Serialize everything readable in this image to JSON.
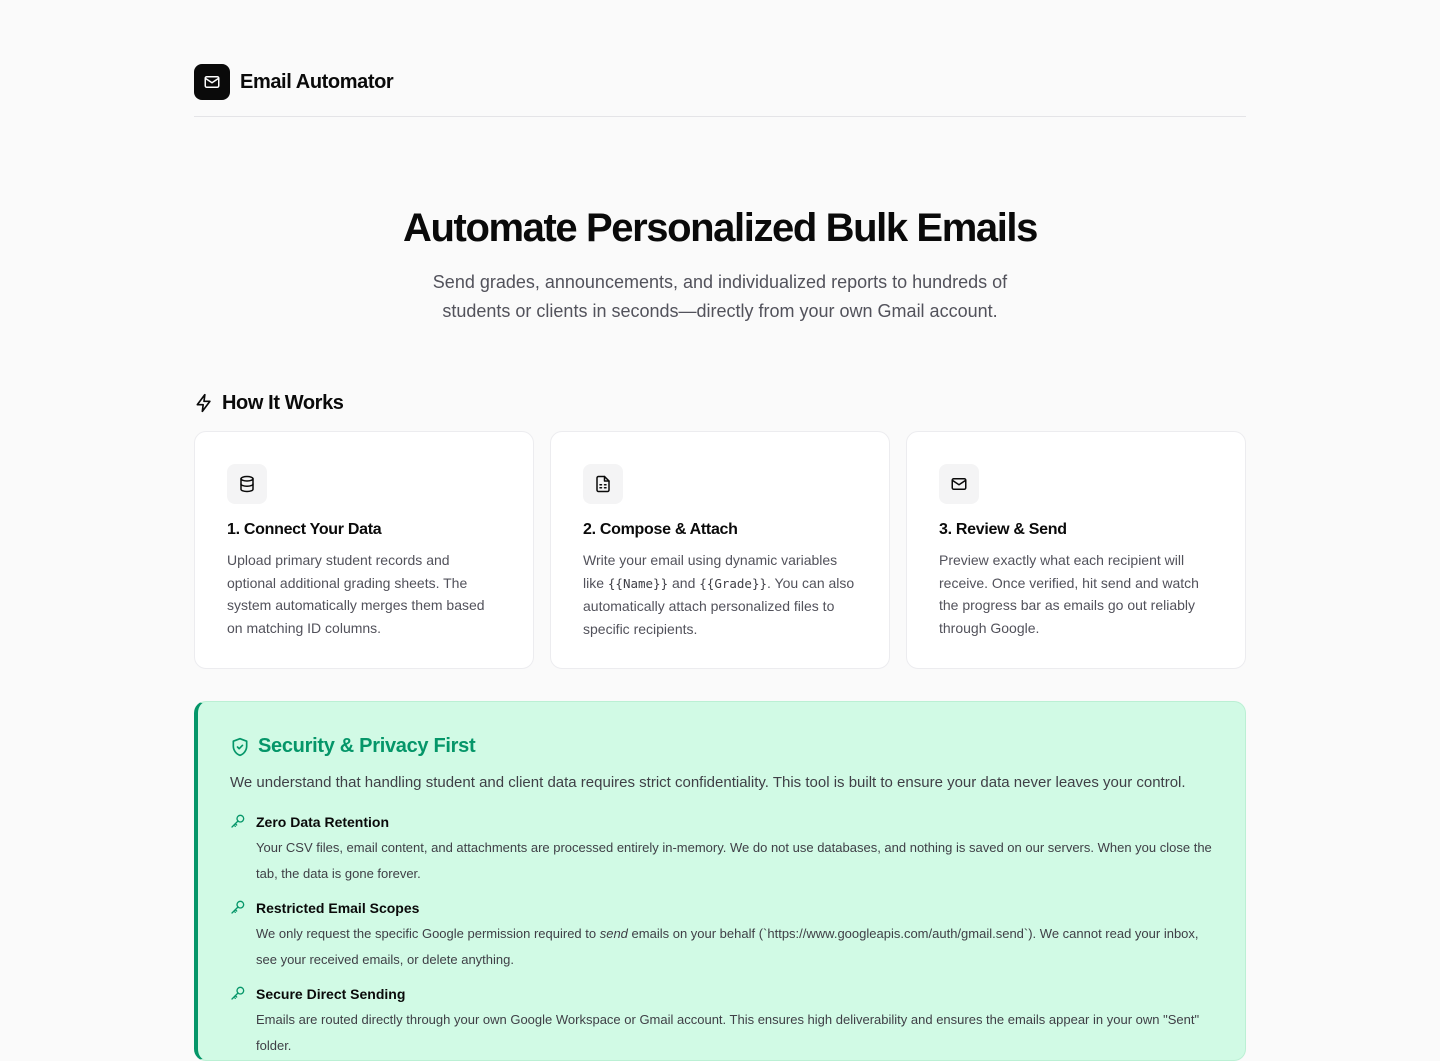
{
  "header": {
    "app_title": "Email Automator",
    "logo_icon": "mail-icon"
  },
  "hero": {
    "title": "Automate Personalized Bulk Emails",
    "subtitle": "Send grades, announcements, and individualized reports to hundreds of students or clients in seconds—directly from your own Gmail account."
  },
  "how_it_works": {
    "title": "How It Works",
    "icon": "lightning-icon",
    "cards": [
      {
        "icon": "database-icon",
        "title": "1. Connect Your Data",
        "description": "Upload primary student records and optional additional grading sheets. The system automatically merges them based on matching ID columns."
      },
      {
        "icon": "document-icon",
        "title": "2. Compose & Attach",
        "desc_part1": "Write your email using dynamic variables like ",
        "var_name": "{{Name}}",
        "desc_and": " and ",
        "var_grade": "{{Grade}}",
        "desc_part2": ". You can also automatically attach personalized files to specific recipients."
      },
      {
        "icon": "mail-icon",
        "title": "3. Review & Send",
        "description": "Preview exactly what each recipient will receive. Once verified, hit send and watch the progress bar as emails go out reliably through Google."
      }
    ]
  },
  "security": {
    "title": "Security & Privacy First",
    "icon": "shield-check-icon",
    "intro": "We understand that handling student and client data requires strict confidentiality. This tool is built to ensure your data never leaves your control.",
    "features": [
      {
        "icon": "key-icon",
        "title": "Zero Data Retention",
        "description": "Your CSV files, email content, and attachments are processed entirely in-memory. We do not use databases, and nothing is saved on our servers. When you close the tab, the data is gone forever."
      },
      {
        "icon": "key-icon",
        "title": "Restricted Email Scopes",
        "desc_part1": "We only request the specific Google permission required to ",
        "desc_em": "send",
        "desc_part2": " emails on your behalf (`https://www.googleapis.com/auth/gmail.send`). We cannot read your inbox, see your received emails, or delete anything."
      },
      {
        "icon": "key-icon",
        "title": "Secure Direct Sending",
        "description": "Emails are routed directly through your own Google Workspace or Gmail account. This ensures high deliverability and ensures the emails appear in your own \"Sent\" folder."
      }
    ]
  },
  "colors": {
    "accent_green": "#059669",
    "security_bg": "#d1fae5",
    "logo_bg": "#0a0a0a"
  }
}
